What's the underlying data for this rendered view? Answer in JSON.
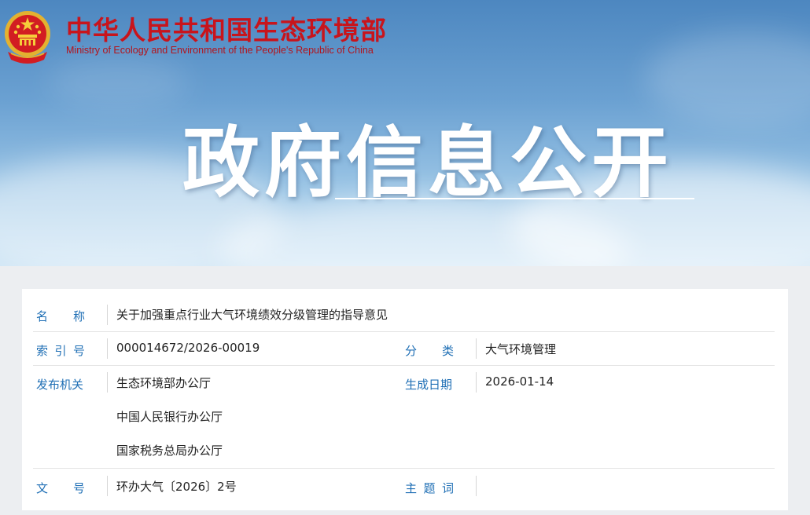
{
  "header": {
    "ministry_name_cn": "中华人民共和国生态环境部",
    "ministry_name_en": "Ministry of Ecology and Environment of the People's Republic of China",
    "banner_title": "政府信息公开",
    "emblem_icon": "national-emblem-icon"
  },
  "record": {
    "name_label": [
      "名",
      "称"
    ],
    "name_value": "关于加强重点行业大气环境绩效分级管理的指导意见",
    "index_label": [
      "索",
      "引",
      "号"
    ],
    "index_value": "000014672/2026-00019",
    "category_label": [
      "分",
      "类"
    ],
    "category_value": "大气环境管理",
    "issuer_label": "发布机关",
    "issuers": [
      "生态环境部办公厅",
      "中国人民银行办公厅",
      "国家税务总局办公厅"
    ],
    "date_label": "生成日期",
    "date_value": "2026-01-14",
    "doc_no_label": [
      "文",
      "号"
    ],
    "doc_no_value": "环办大气〔2026〕2号",
    "subject_label": [
      "主",
      "题",
      "词"
    ],
    "subject_value": ""
  },
  "colors": {
    "label_blue": "#1f6fb5",
    "ministry_red": "#c8141c"
  }
}
